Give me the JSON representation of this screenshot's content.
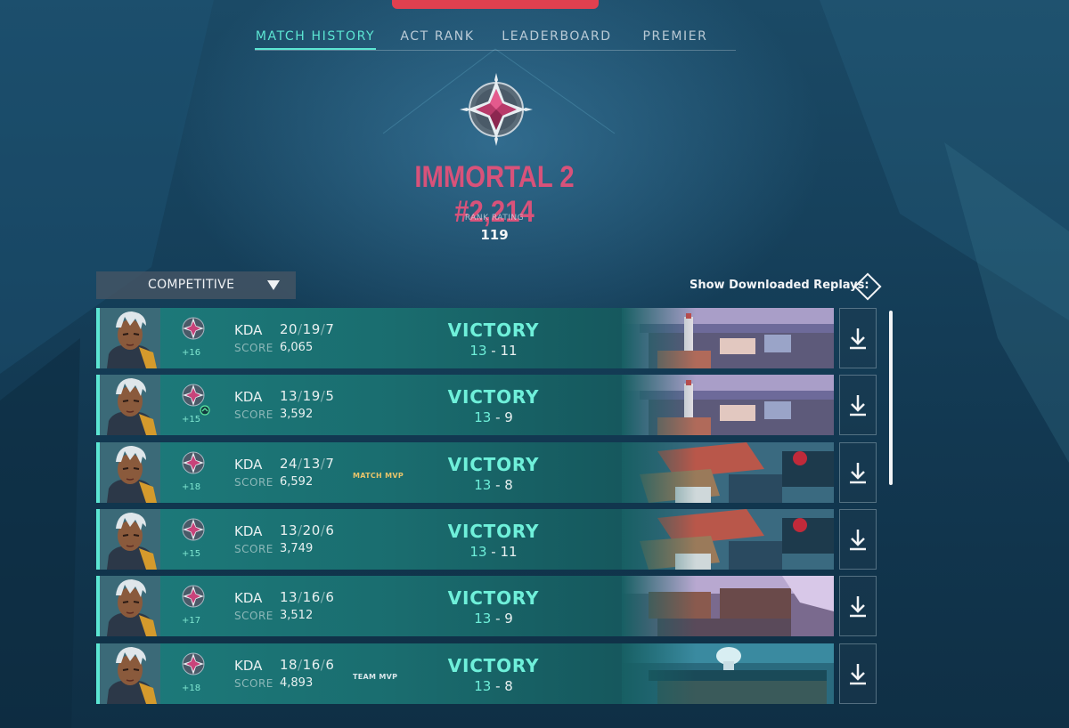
{
  "tabs": [
    {
      "label": "MATCH HISTORY",
      "active": true
    },
    {
      "label": "ACT RANK",
      "active": false
    },
    {
      "label": "LEADERBOARD",
      "active": false
    },
    {
      "label": "PREMIER",
      "active": false
    }
  ],
  "rank": {
    "title": "IMMORTAL 2 #2,214",
    "rating_label": "RANK RATING",
    "rating_value": "119",
    "emblem_icon": "immortal-rank-icon"
  },
  "filter": {
    "mode_label": "COMPETITIVE",
    "replays_label": "Show Downloaded Replays:"
  },
  "colors": {
    "accent": "#5ce6d3",
    "victory": "#6ff0da",
    "rank_title": "#d8527a",
    "mvp_gold": "#e8c46a"
  },
  "matches": [
    {
      "rr_gain": "+16",
      "kda_label": "KDA",
      "k": "20",
      "d": "19",
      "a": "7",
      "score_label": "SCORE",
      "score": "6,065",
      "mvp": "",
      "result": "VICTORY",
      "team_score": "13",
      "dash": "-",
      "enemy_score": "11",
      "map": "map-city-dusk",
      "placement_icon": false
    },
    {
      "rr_gain": "+15",
      "kda_label": "KDA",
      "k": "13",
      "d": "19",
      "a": "5",
      "score_label": "SCORE",
      "score": "3,592",
      "mvp": "",
      "result": "VICTORY",
      "team_score": "13",
      "dash": "-",
      "enemy_score": "9",
      "map": "map-city-dusk",
      "placement_icon": true
    },
    {
      "rr_gain": "+18",
      "kda_label": "KDA",
      "k": "24",
      "d": "13",
      "a": "7",
      "score_label": "SCORE",
      "score": "6,592",
      "mvp": "MATCH MVP",
      "result": "VICTORY",
      "team_score": "13",
      "dash": "-",
      "enemy_score": "8",
      "map": "map-rooftops",
      "placement_icon": false
    },
    {
      "rr_gain": "+15",
      "kda_label": "KDA",
      "k": "13",
      "d": "20",
      "a": "6",
      "score_label": "SCORE",
      "score": "3,749",
      "mvp": "",
      "result": "VICTORY",
      "team_score": "13",
      "dash": "-",
      "enemy_score": "11",
      "map": "map-rooftops",
      "placement_icon": false
    },
    {
      "rr_gain": "+17",
      "kda_label": "KDA",
      "k": "13",
      "d": "16",
      "a": "6",
      "score_label": "SCORE",
      "score": "3,512",
      "mvp": "",
      "result": "VICTORY",
      "team_score": "13",
      "dash": "-",
      "enemy_score": "9",
      "map": "map-ruins",
      "placement_icon": false
    },
    {
      "rr_gain": "+18",
      "kda_label": "KDA",
      "k": "18",
      "d": "16",
      "a": "6",
      "score_label": "SCORE",
      "score": "4,893",
      "mvp": "TEAM MVP",
      "result": "VICTORY",
      "team_score": "13",
      "dash": "-",
      "enemy_score": "8",
      "map": "map-coast",
      "placement_icon": false
    }
  ]
}
